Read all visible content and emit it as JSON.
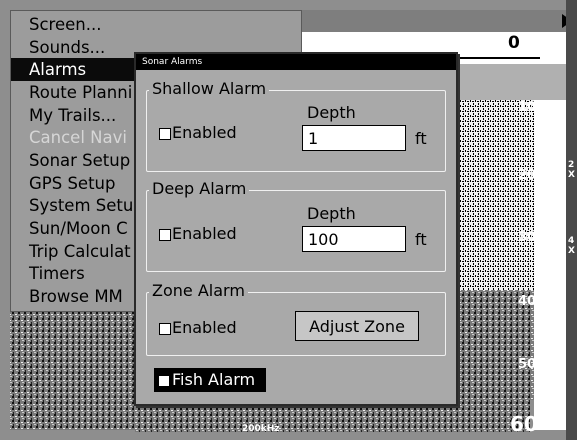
{
  "menu": {
    "items": [
      {
        "label": "Screen...",
        "state": "normal"
      },
      {
        "label": "Sounds...",
        "state": "normal"
      },
      {
        "label": "Alarms",
        "state": "selected"
      },
      {
        "label": "Route Planni",
        "state": "normal"
      },
      {
        "label": "My Trails...",
        "state": "normal"
      },
      {
        "label": "Cancel Navi",
        "state": "disabled"
      },
      {
        "label": "Sonar Setup",
        "state": "normal"
      },
      {
        "label": "GPS Setup",
        "state": "normal"
      },
      {
        "label": "System Setu",
        "state": "normal"
      },
      {
        "label": "Sun/Moon C",
        "state": "normal"
      },
      {
        "label": "Trip Calculat",
        "state": "normal"
      },
      {
        "label": "Timers",
        "state": "normal"
      },
      {
        "label": "Browse MM",
        "state": "normal"
      }
    ]
  },
  "dialog": {
    "title": "Sonar Alarms",
    "shallow": {
      "title": "Shallow Alarm",
      "enabled_label": "Enabled",
      "enabled": false,
      "depth_label": "Depth",
      "depth_value": "1",
      "unit": "ft"
    },
    "deep": {
      "title": "Deep Alarm",
      "enabled_label": "Enabled",
      "enabled": false,
      "depth_label": "Depth",
      "depth_value": "100",
      "unit": "ft"
    },
    "zone": {
      "title": "Zone Alarm",
      "enabled_label": "Enabled",
      "enabled": false,
      "button_label": "Adjust Zone"
    },
    "fish": {
      "label": "Fish Alarm",
      "enabled": false
    }
  },
  "sonar": {
    "depth_scale": [
      "10",
      "20",
      "30",
      "40",
      "50",
      "60"
    ],
    "top_depth": "0",
    "frequency": "200kHz",
    "zoom_labels": [
      "2X",
      "4X"
    ]
  }
}
